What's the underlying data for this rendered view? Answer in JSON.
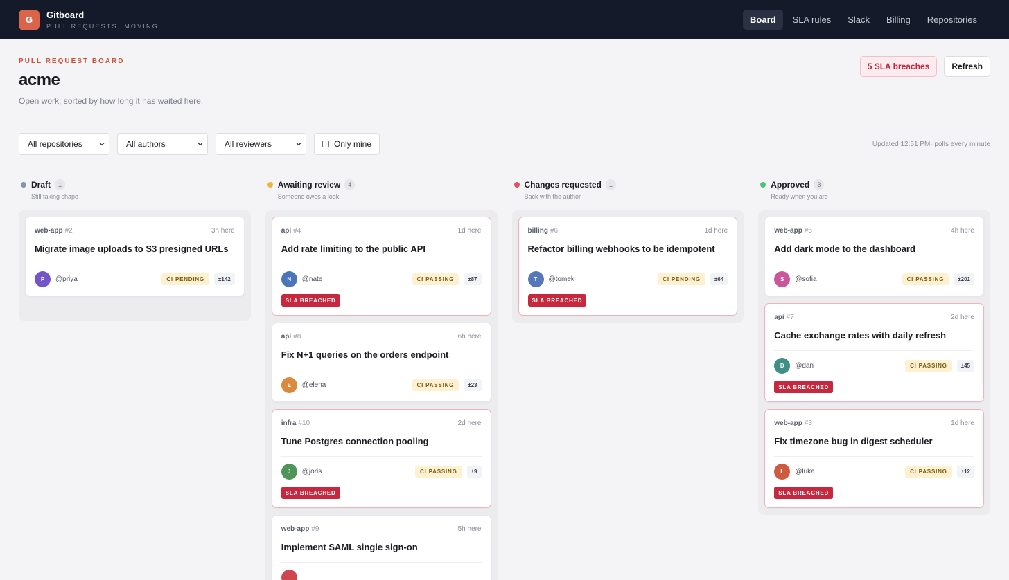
{
  "brand": {
    "logo_letter": "G",
    "name": "Gitboard",
    "tagline": "PULL REQUESTS, MOVING"
  },
  "nav": [
    {
      "label": "Board",
      "active": true
    },
    {
      "label": "SLA rules",
      "active": false
    },
    {
      "label": "Slack",
      "active": false
    },
    {
      "label": "Billing",
      "active": false
    },
    {
      "label": "Repositories",
      "active": false
    }
  ],
  "header": {
    "eyebrow": "PULL REQUEST BOARD",
    "title": "acme",
    "subtitle": "Open work, sorted by how long it has waited here.",
    "breach_badge": "5 SLA breaches",
    "refresh_label": "Refresh"
  },
  "filters": {
    "repositories": "All repositories",
    "authors": "All authors",
    "reviewers": "All reviewers",
    "only_mine": "Only mine",
    "only_mine_checked": false,
    "updated": "Updated 12:51 PM· polls every minute"
  },
  "sla_label": "SLA BREACHED",
  "columns": [
    {
      "key": "draft",
      "name": "Draft",
      "count": "1",
      "subtitle": "Still taking shape",
      "dot_color": "#8b93a7",
      "cards": [
        {
          "repo": "web-app",
          "number": "#2",
          "age": "3h here",
          "title": "Migrate image uploads to S3 presigned URLs",
          "avatar_letter": "P",
          "avatar_color": "#7354c9",
          "author": "@priya",
          "ci": "CI PENDING",
          "diff": "±142",
          "breached": false
        }
      ]
    },
    {
      "key": "awaiting",
      "name": "Awaiting review",
      "count": "4",
      "subtitle": "Someone owes a look",
      "dot_color": "#ecb53c",
      "cards": [
        {
          "repo": "api",
          "number": "#4",
          "age": "1d here",
          "title": "Add rate limiting to the public API",
          "avatar_letter": "N",
          "avatar_color": "#4a76b9",
          "author": "@nate",
          "ci": "CI PASSING",
          "diff": "±87",
          "breached": true
        },
        {
          "repo": "api",
          "number": "#8",
          "age": "6h here",
          "title": "Fix N+1 queries on the orders endpoint",
          "avatar_letter": "E",
          "avatar_color": "#d98a3f",
          "author": "@elena",
          "ci": "CI PASSING",
          "diff": "±23",
          "breached": false
        },
        {
          "repo": "infra",
          "number": "#10",
          "age": "2d here",
          "title": "Tune Postgres connection pooling",
          "avatar_letter": "J",
          "avatar_color": "#4f9458",
          "author": "@joris",
          "ci": "CI PASSING",
          "diff": "±9",
          "breached": true
        },
        {
          "repo": "web-app",
          "number": "#9",
          "age": "5h here",
          "title": "Implement SAML single sign-on",
          "avatar_letter": "",
          "avatar_color": "#d0464f",
          "author": "",
          "ci": "",
          "diff": "",
          "breached": false
        }
      ]
    },
    {
      "key": "changes",
      "name": "Changes requested",
      "count": "1",
      "subtitle": "Back with the author",
      "dot_color": "#e0535f",
      "cards": [
        {
          "repo": "billing",
          "number": "#6",
          "age": "1d here",
          "title": "Refactor billing webhooks to be idempotent",
          "avatar_letter": "T",
          "avatar_color": "#5778b8",
          "author": "@tomek",
          "ci": "CI PENDING",
          "diff": "±64",
          "breached": true
        }
      ]
    },
    {
      "key": "approved",
      "name": "Approved",
      "count": "3",
      "subtitle": "Ready when you are",
      "dot_color": "#4ec27a",
      "cards": [
        {
          "repo": "web-app",
          "number": "#5",
          "age": "4h here",
          "title": "Add dark mode to the dashboard",
          "avatar_letter": "S",
          "avatar_color": "#c9579a",
          "author": "@sofia",
          "ci": "CI PASSING",
          "diff": "±201",
          "breached": false
        },
        {
          "repo": "api",
          "number": "#7",
          "age": "2d here",
          "title": "Cache exchange rates with daily refresh",
          "avatar_letter": "D",
          "avatar_color": "#3f8f87",
          "author": "@dan",
          "ci": "CI PASSING",
          "diff": "±45",
          "breached": true
        },
        {
          "repo": "web-app",
          "number": "#3",
          "age": "1d here",
          "title": "Fix timezone bug in digest scheduler",
          "avatar_letter": "L",
          "avatar_color": "#cf5b3e",
          "author": "@luka",
          "ci": "CI PASSING",
          "diff": "±12",
          "breached": true
        }
      ]
    }
  ]
}
